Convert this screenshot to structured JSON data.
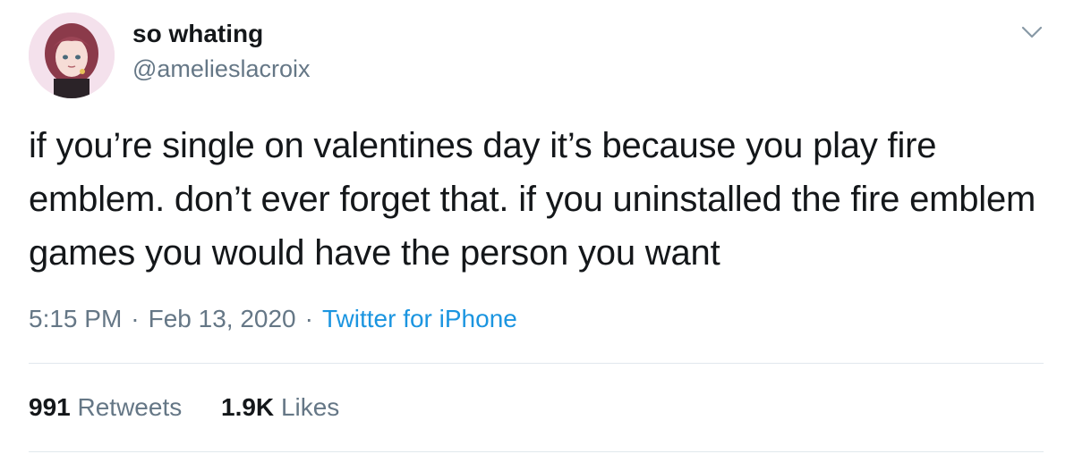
{
  "author": {
    "display_name": "so whating",
    "handle": "@amelieslacroix"
  },
  "tweet": {
    "text": "if you’re single on valentines day it’s because you play fire emblem. don’t ever forget that. if you uninstalled the fire emblem games you would have the person you want"
  },
  "meta": {
    "time": "5:15 PM",
    "separator": "·",
    "date": "Feb 13, 2020",
    "source": "Twitter for iPhone"
  },
  "stats": {
    "retweets_count": "991",
    "retweets_label": "Retweets",
    "likes_count": "1.9K",
    "likes_label": "Likes"
  },
  "icons": {
    "caret": "chevron-down-icon",
    "avatar": "avatar"
  },
  "colors": {
    "text": "#14171a",
    "secondary": "#657786",
    "link": "#1b95e0",
    "divider": "#e1e8ed"
  }
}
